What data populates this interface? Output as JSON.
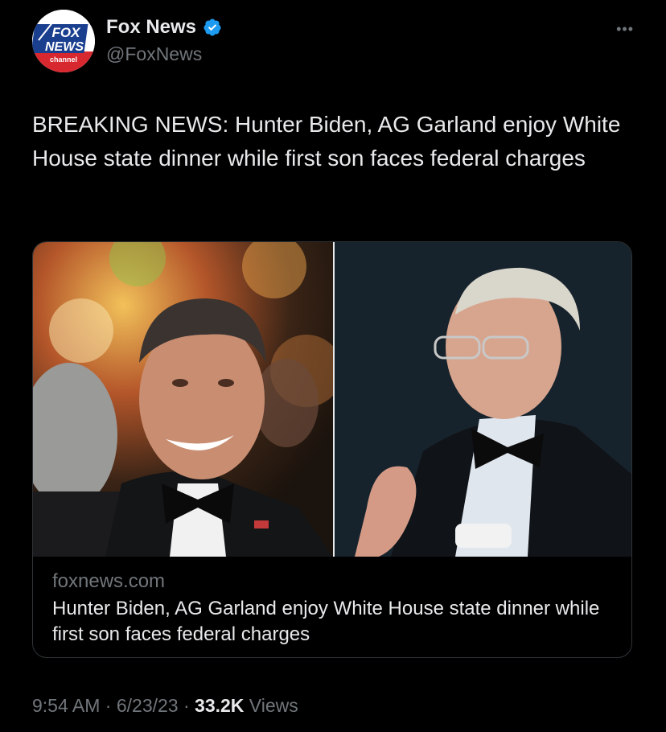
{
  "author": {
    "display_name": "Fox News",
    "handle": "@FoxNews",
    "avatar_text_top": "FOX",
    "avatar_text_mid": "NEWS",
    "avatar_text_bottom": "channel"
  },
  "more_label": "•••",
  "tweet": {
    "text": "BREAKING NEWS: Hunter Biden, AG Garland enjoy White House state dinner while first son faces federal charges"
  },
  "link_card": {
    "domain": "foxnews.com",
    "title": "Hunter Biden, AG Garland enjoy White House state dinner while first son faces federal charges"
  },
  "meta": {
    "time": "9:54 AM",
    "sep1": " · ",
    "date": "6/23/23",
    "sep2": " · ",
    "views_count": "33.2K",
    "views_label": " Views"
  },
  "colors": {
    "background": "#000000",
    "text_primary": "#e7e9ea",
    "text_secondary": "#71767b",
    "verified_badge": "#1d9bf0",
    "border": "#2f3336"
  }
}
